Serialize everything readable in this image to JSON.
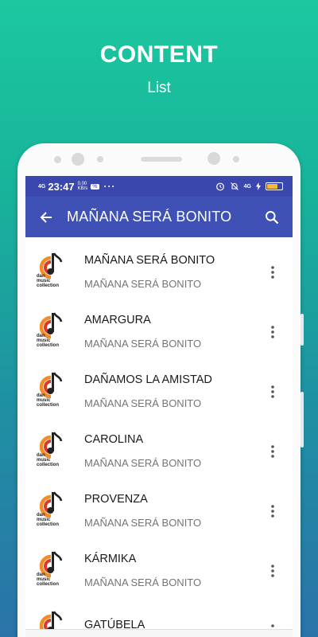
{
  "promo": {
    "title": "CONTENT",
    "subtitle": "List"
  },
  "status": {
    "network": "4G",
    "time": "23:47",
    "speed_value": "0.00",
    "speed_unit": "KB/s",
    "badge": "%",
    "dots": "···",
    "right_network": "4G",
    "battery_level": 0.7
  },
  "toolbar": {
    "title": "MAÑANA SERÁ BONITO"
  },
  "logo_text": [
    "dan",
    "music",
    "collection"
  ],
  "songs": [
    {
      "name": "MAÑANA SERÁ BONITO",
      "artist": "MAÑANA SERÁ BONITO"
    },
    {
      "name": "AMARGURA",
      "artist": "MAÑANA SERÁ BONITO"
    },
    {
      "name": "DAÑAMOS LA AMISTAD",
      "artist": "MAÑANA SERÁ BONITO"
    },
    {
      "name": "CAROLINA",
      "artist": "MAÑANA SERÁ BONITO"
    },
    {
      "name": "PROVENZA",
      "artist": "MAÑANA SERÁ BONITO"
    },
    {
      "name": "KÁRMIKA",
      "artist": "MAÑANA SERÁ BONITO"
    },
    {
      "name": "GATÚBELA",
      "artist": ""
    }
  ],
  "colors": {
    "primary": "#3f51b5",
    "status_bar": "#3a47ad",
    "logo_orange": "#f28c28",
    "logo_red": "#d93a2b"
  }
}
